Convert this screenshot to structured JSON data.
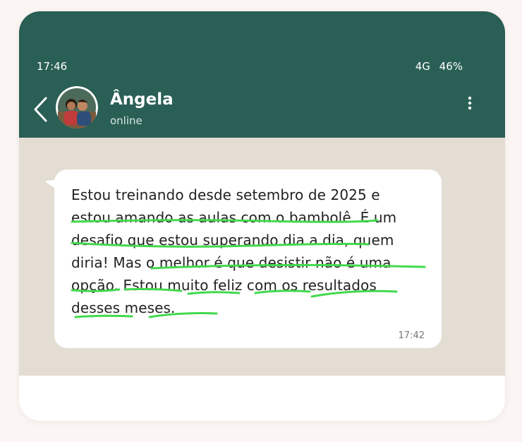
{
  "status_bar": {
    "time": "17:46",
    "network": "4G",
    "battery": "46%"
  },
  "header": {
    "contact_name": "Ângela",
    "contact_status": "online"
  },
  "message": {
    "text": "Estou treinando desde setembro de 2025 e\nestou amando as aulas com o bambolê. É um\ndesafio que estou superando dia a dia, quem\ndiria! Mas o melhor é que desistir não é uma\nopção. Estou muito feliz com os resultados\ndesses meses.",
    "time": "17:42"
  },
  "colors": {
    "header": "#2a5f55",
    "chat_background": "#e4ddd3",
    "bubble": "#ffffff",
    "highlight_underline": "#43d94e"
  }
}
